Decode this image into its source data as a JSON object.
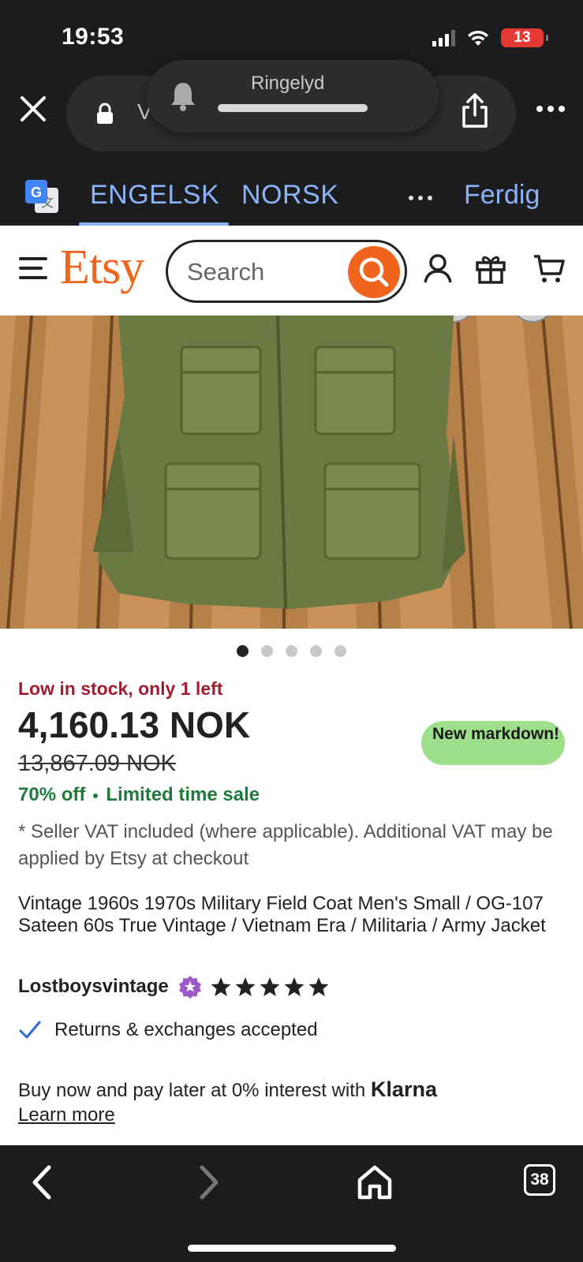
{
  "status_bar": {
    "time": "19:53",
    "battery": "13"
  },
  "browser": {
    "url_text": "V",
    "ringer_label": "Ringelyd"
  },
  "translate": {
    "source_lang": "ENGELSK",
    "target_lang": "NORSK",
    "done_label": "Ferdig"
  },
  "header": {
    "logo": "Etsy",
    "search_placeholder": "Search"
  },
  "product": {
    "image_count": 5,
    "active_image": 1,
    "stock_text": "Low in stock, only 1 left",
    "price": "4,160.13 NOK",
    "original_price": "13,867.09 NOK",
    "markdown_badge": "New markdown!",
    "discount": "70% off",
    "sale_label": "Limited time sale",
    "vat_note": "* Seller VAT included (where applicable). Additional VAT may be applied by Etsy at checkout",
    "title": "Vintage 1960s 1970s Military Field Coat Men's Small / OG-107 Sateen 60s True Vintage / Vietnam Era / Militaria / Army Jacket",
    "seller": "Lostboysvintage",
    "rating": 5,
    "returns": "Returns & exchanges accepted",
    "klarna_text": "Buy now and pay later at 0% interest with",
    "klarna_brand": "Klarna",
    "learn_more": "Learn more"
  },
  "bottom_nav": {
    "tab_count": "38"
  },
  "colors": {
    "etsy_orange": "#f1641e",
    "stock_red": "#a61a2e",
    "sale_green": "#1f7a3c",
    "badge_green": "#9edf8c",
    "translate_blue": "#8ab4f8"
  }
}
